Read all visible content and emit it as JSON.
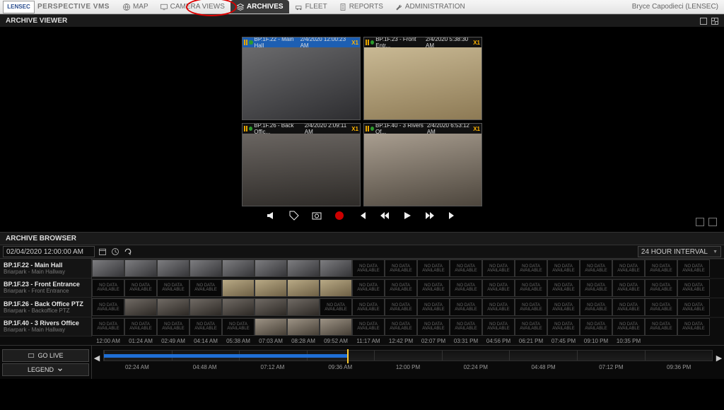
{
  "app": {
    "brand": "LENSEC",
    "product": "PERSPECTIVE VMS"
  },
  "nav": {
    "items": [
      {
        "id": "map",
        "label": "MAP"
      },
      {
        "id": "cameraviews",
        "label": "CAMERA VIEWS"
      },
      {
        "id": "archives",
        "label": "ARCHIVES",
        "active": true
      },
      {
        "id": "fleet",
        "label": "FLEET"
      },
      {
        "id": "reports",
        "label": "REPORTS"
      },
      {
        "id": "administration",
        "label": "ADMINISTRATION"
      }
    ]
  },
  "user": {
    "display": "Bryce Capodieci (LENSEC)"
  },
  "sections": {
    "viewer": "ARCHIVE VIEWER",
    "browser": "ARCHIVE BROWSER"
  },
  "viewer": {
    "tiles": [
      {
        "name": "BP.1F.22 - Main Hall",
        "ts": "2/4/2020 12:00:23 AM",
        "speed": "X1",
        "selected": true
      },
      {
        "name": "BP.1F.23 - Front Entr...",
        "ts": "2/4/2020 5:38:30 AM",
        "speed": "X1",
        "selected": false
      },
      {
        "name": "BP.1F.26 - Back Offic...",
        "ts": "2/4/2020 2:09:11 AM",
        "speed": "X1",
        "selected": false
      },
      {
        "name": "BP.1F.40 - 3 Rivers Of...",
        "ts": "2/4/2020 6:53:12 AM",
        "speed": "X1",
        "selected": false
      }
    ]
  },
  "browser": {
    "datetime": "02/04/2020 12:00:00 AM",
    "interval": "24 HOUR INTERVAL",
    "cameras": [
      {
        "name": "BP.1F.22 - Main Hall",
        "sub": "Briarpark - Main Hallway",
        "thumbs": [
          "t-hall",
          "t-hall",
          "t-hall",
          "t-hall",
          "t-hall",
          "t-hall",
          "t-hall",
          "t-hall",
          "nodata",
          "nodata",
          "nodata",
          "nodata",
          "nodata",
          "nodata",
          "nodata",
          "nodata",
          "nodata",
          "nodata",
          "nodata"
        ]
      },
      {
        "name": "BP.1F.23 - Front Entrance",
        "sub": "Briarpark - Front Entrance",
        "thumbs": [
          "nodata",
          "nodata",
          "nodata",
          "nodata",
          "t-ent",
          "t-ent",
          "t-ent",
          "t-ent",
          "nodata",
          "nodata",
          "nodata",
          "nodata",
          "nodata",
          "nodata",
          "nodata",
          "nodata",
          "nodata",
          "nodata",
          "nodata"
        ]
      },
      {
        "name": "BP.1F.26 - Back Office PTZ",
        "sub": "Briarpark - Backoffice PTZ",
        "thumbs": [
          "nodata",
          "t-ptz",
          "t-ptz",
          "t-ptz",
          "t-ptz",
          "t-ptz",
          "t-ptz",
          "nodata",
          "nodata",
          "nodata",
          "nodata",
          "nodata",
          "nodata",
          "nodata",
          "nodata",
          "nodata",
          "nodata",
          "nodata",
          "nodata"
        ]
      },
      {
        "name": "BP.1F.40 - 3 Rivers Office",
        "sub": "Briarpark - Main Hallway",
        "thumbs": [
          "nodata",
          "nodata",
          "nodata",
          "nodata",
          "nodata",
          "t-of",
          "t-of",
          "t-of",
          "nodata",
          "nodata",
          "nodata",
          "nodata",
          "nodata",
          "nodata",
          "nodata",
          "nodata",
          "nodata",
          "nodata",
          "nodata"
        ]
      }
    ],
    "timeAxis": [
      "12:00 AM",
      "01:24 AM",
      "02:49 AM",
      "04:14 AM",
      "05:38 AM",
      "07:03 AM",
      "08:28 AM",
      "09:52 AM",
      "11:17 AM",
      "12:42 PM",
      "02:07 PM",
      "03:31 PM",
      "04:56 PM",
      "06:21 PM",
      "07:45 PM",
      "09:10 PM",
      "10:35 PM"
    ],
    "nodataLabel": "NO DATA AVAILABLE"
  },
  "bottom": {
    "golive": "GO LIVE",
    "legend": "LEGEND",
    "timelineLabels": [
      "02:24 AM",
      "04:48 AM",
      "07:12 AM",
      "09:36 AM",
      "12:00 PM",
      "02:24 PM",
      "04:48 PM",
      "07:12 PM",
      "09:36 PM"
    ]
  }
}
